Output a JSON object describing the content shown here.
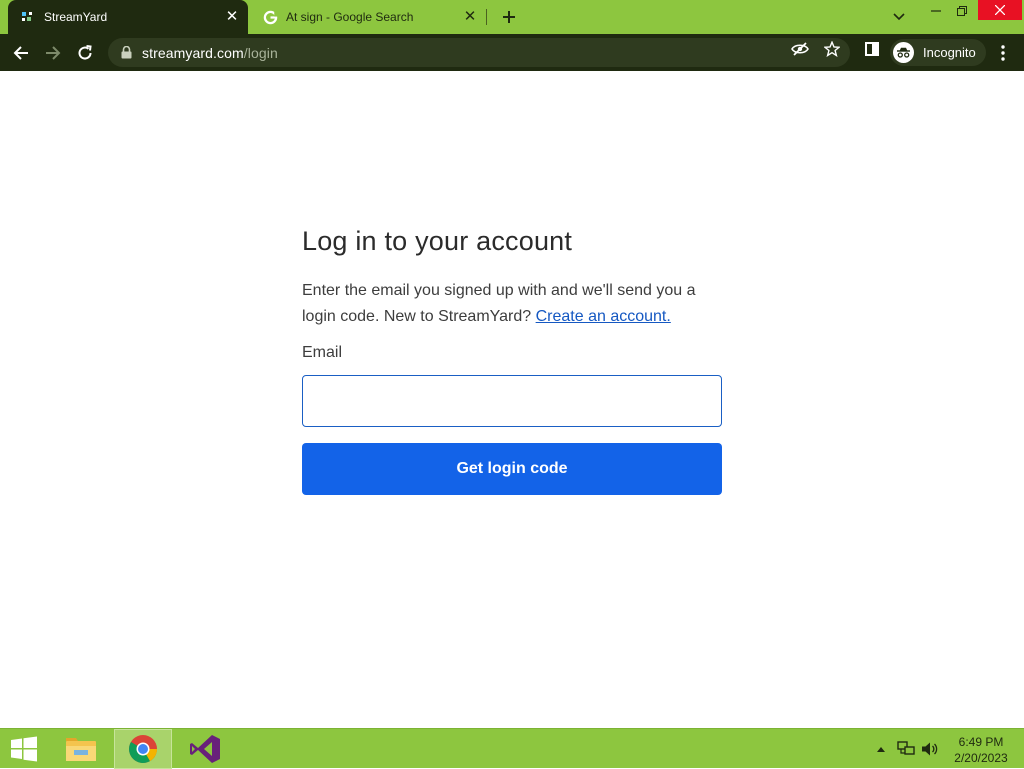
{
  "browser": {
    "tabs": [
      {
        "title": "StreamYard",
        "active": true,
        "favicon": "streamyard-icon"
      },
      {
        "title": "At sign - Google Search",
        "active": false,
        "favicon": "google-icon"
      }
    ],
    "url_host": "streamyard.com",
    "url_path": "/login",
    "profile_label": "Incognito"
  },
  "page": {
    "heading": "Log in to your account",
    "description": "Enter the email you signed up with and we'll send you a login code. New to StreamYard?",
    "create_account_link": "Create an account.",
    "email_label": "Email",
    "email_value": "",
    "submit_label": "Get login code"
  },
  "taskbar": {
    "apps": [
      "start-icon",
      "file-explorer-icon",
      "chrome-icon",
      "visual-studio-icon"
    ],
    "time": "6:49 PM",
    "date": "2/20/2023"
  },
  "colors": {
    "accent_green": "#8dc63f",
    "dark_chrome": "#1f2a10",
    "primary_button": "#1363e8",
    "link": "#1558c2"
  }
}
